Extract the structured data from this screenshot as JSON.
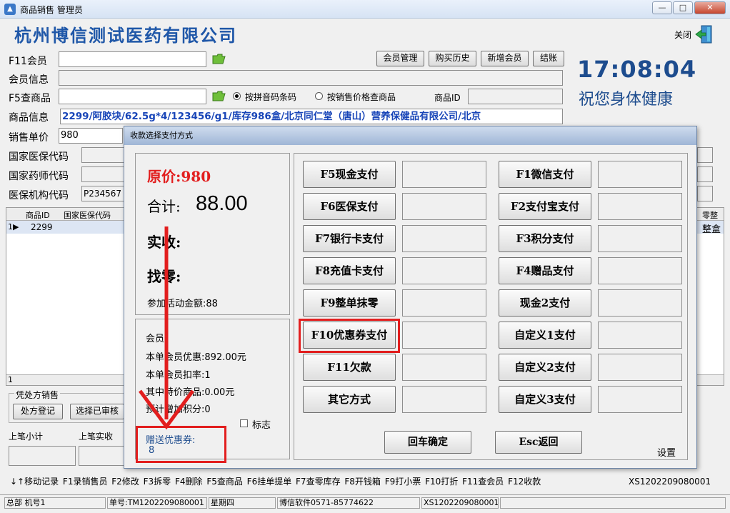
{
  "window": {
    "title": "商品销售 管理员",
    "company": "杭州博信测试医药有限公司",
    "close_label": "关闭"
  },
  "member": {
    "f11_label": "F11会员",
    "info_label": "会员信息",
    "f5_label": "F5查商品",
    "buttons": [
      "会员管理",
      "购买历史",
      "新增会员",
      "结账"
    ]
  },
  "search_mode": {
    "option1": "按拼音码条码",
    "option2": "按销售价格查商品",
    "product_id_label": "商品ID"
  },
  "clock": "17:08:04",
  "slogan": "祝您身体健康",
  "product": {
    "info_label": "商品信息",
    "info_value": "2299/阿胶块/62.5g*4/123456/g1/库存986盒/北京同仁堂（唐山）营养保健品有限公司/北京",
    "price_label": "销售单价",
    "price_value": "980",
    "nat_ins_label": "国家医保代码",
    "pharm_label": "国家药师代码",
    "org_label": "医保机构代码",
    "org_value": "P234567"
  },
  "grid": {
    "headers": [
      "商品ID",
      "国家医保代码",
      "零整"
    ],
    "rows": [
      {
        "marker": "1▶",
        "id": "2299",
        "unit": "整盒"
      }
    ],
    "footer_count": "1"
  },
  "prescription": {
    "title": "凭处方销售",
    "btn1": "处方登记",
    "btn2": "选择已审核"
  },
  "bottom": {
    "last_subtotal": "上笔小计",
    "last_paid": "上笔实收"
  },
  "shortcuts": "↓↑移动记录  F1录销售员  F2修改  F3拆零  F4删除  F5查商品  F6挂单提单  F7查零库存  F8开钱箱  F9打小票  F10打折  F11查会员  F12收款",
  "shortcut_code": "XS1202209080001",
  "statusbar": {
    "branch": "总部 机号1",
    "order": "单号:TM1202209080001",
    "weekday": "星期四",
    "company": "博信软件0571-85774622",
    "code": "XS1202209080001"
  },
  "dialog": {
    "title": "收款选择支付方式",
    "original_price": "原价:980",
    "total_label": "合计:",
    "total_value": "88.00",
    "paid_label": "实收:",
    "change_label": "找零:",
    "activity_amount": "参加活动金额:88",
    "member": "会员:",
    "member_discount": "本单会员优惠:892.00元",
    "member_rate": "本单会员扣率:1",
    "special_items": "其中特价商品:0.00元",
    "points": "预计增加积分:0",
    "flag_label": "标志",
    "coupon_label": "赠送优惠券:",
    "coupon_value": "8",
    "pay_left": [
      "F5现金支付",
      "F6医保支付",
      "F7银行卡支付",
      "F8充值卡支付",
      "F9整单抹零",
      "F10优惠券支付",
      "F11欠款",
      "其它方式"
    ],
    "pay_right": [
      "F1微信支付",
      "F2支付宝支付",
      "F3积分支付",
      "F4赠品支付",
      "现金2支付",
      "自定义1支付",
      "自定义2支付",
      "自定义3支付"
    ],
    "confirm": "回车确定",
    "back": "Esc返回",
    "settings": "设置"
  },
  "colors": {
    "company": "#1f57a8",
    "clock": "#1d4c8e",
    "price": "#e21e1e",
    "product_info": "#1845b8",
    "highlight": "#e21e1e"
  }
}
